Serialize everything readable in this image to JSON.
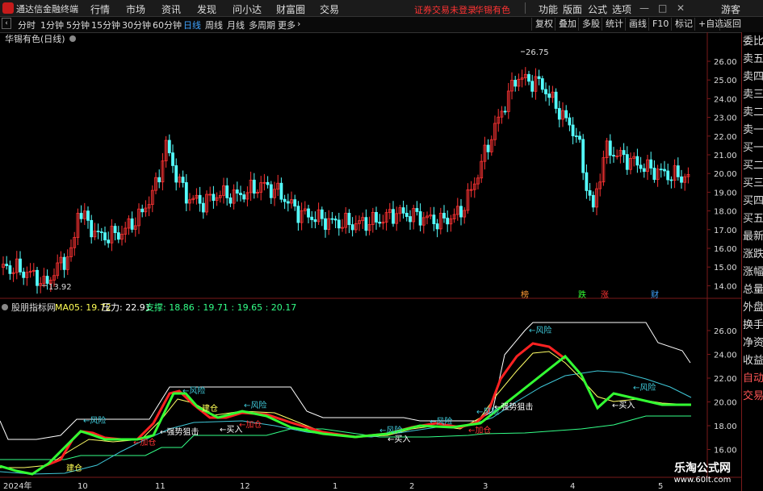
{
  "titlebar": {
    "app_name": "通达信金融终端",
    "menus": [
      "行情",
      "市场",
      "资讯",
      "发现",
      "问小达",
      "财富圈",
      "交易"
    ],
    "warning": "证券交易未登录",
    "stock": "华锡有色",
    "right": [
      "功能",
      "版面",
      "公式",
      "选项"
    ],
    "guest": "游客"
  },
  "toolbar": {
    "periods": [
      "分时",
      "1分钟",
      "5分钟",
      "15分钟",
      "30分钟",
      "60分钟",
      "日线",
      "周线",
      "月线",
      "多周期",
      "更多"
    ],
    "active_period": "日线",
    "right": [
      "复权",
      "叠加",
      "多股",
      "统计",
      "画线",
      "F10",
      "标记",
      "+自选",
      "返回"
    ]
  },
  "main_chart": {
    "label": "华锡有色(日线)",
    "y_ticks": [
      "26.00",
      "25.00",
      "24.00",
      "23.00",
      "22.00",
      "21.00",
      "20.00",
      "19.00",
      "18.00",
      "17.00",
      "16.00",
      "15.00",
      "14.00"
    ],
    "high_label": "26.75",
    "low_label": "13.92",
    "markers": [
      "榜",
      "跌",
      "涨",
      "财"
    ],
    "colors": {
      "up": "#ff3333",
      "down": "#54ffff"
    }
  },
  "indicator": {
    "name": "股朋指标网",
    "ma_label": "MA05: 19.72",
    "pressure": "压力: 22.91",
    "support": "支撑: 18.86 : 19.71 : 19.65 : 20.17",
    "y_ticks": [
      "26.00",
      "24.00",
      "22.00",
      "20.00",
      "18.00",
      "16.00"
    ],
    "annotations": [
      "←风险",
      "←风险",
      "←风险",
      "←风险",
      "←风险",
      "←风险",
      "←风险",
      "←风险",
      "←强势狙击",
      "←强势狙击",
      "←加仓",
      "←加仓",
      "←加仓",
      "建仓",
      "建仓",
      "←买入",
      "←买入",
      "←买入"
    ]
  },
  "x_axis": [
    "2024年",
    "10",
    "11",
    "12",
    "1",
    "2",
    "3",
    "4",
    "5"
  ],
  "sidebar": [
    "委比",
    "卖五",
    "卖四",
    "卖三",
    "卖二",
    "卖一",
    "买一",
    "买二",
    "买三",
    "买四",
    "买五",
    "最新",
    "涨跌",
    "涨幅",
    "总量",
    "外盘",
    "换手",
    "净资",
    "收益",
    "自动",
    "交易"
  ],
  "watermark": {
    "line1": "乐淘公式网",
    "line2": "www.60lt.com"
  }
}
